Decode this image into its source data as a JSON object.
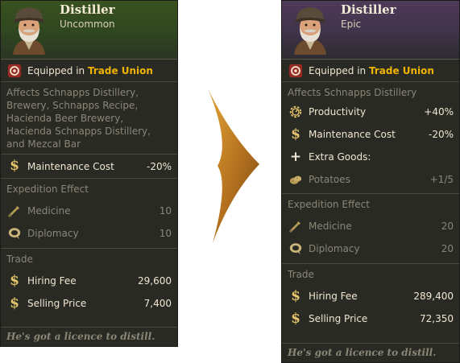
{
  "colors": {
    "uncommon": "#3a5220",
    "epic": "#4f3a5a",
    "highlight": "#f0b400",
    "gold": "#e4c46a"
  },
  "left": {
    "name": "Distiller",
    "rarity": "Uncommon",
    "equipped_prefix": "Equipped in",
    "equipped_place": "Trade Union",
    "affects": "Affects Schnapps Distillery, Brewery, Schnapps Recipe, Hacienda Beer Brewery, Hacienda Schnapps Distillery, and Mezcal Bar",
    "maintenance": {
      "label": "Maintenance Cost",
      "value": "-20%"
    },
    "expedition_title": "Expedition Effect",
    "medicine": {
      "label": "Medicine",
      "value": "10"
    },
    "diplomacy": {
      "label": "Diplomacy",
      "value": "10"
    },
    "trade_title": "Trade",
    "hiring": {
      "label": "Hiring Fee",
      "value": "29,600"
    },
    "selling": {
      "label": "Selling Price",
      "value": "7,400"
    },
    "flavor": "He's got a licence to distill."
  },
  "right": {
    "name": "Distiller",
    "rarity": "Epic",
    "equipped_prefix": "Equipped in",
    "equipped_place": "Trade Union",
    "affects": "Affects Schnapps Distillery",
    "productivity": {
      "label": "Productivity",
      "value": "+40%"
    },
    "maintenance": {
      "label": "Maintenance Cost",
      "value": "-20%"
    },
    "extra_goods": {
      "label": "Extra Goods:"
    },
    "potatoes": {
      "label": "Potatoes",
      "value": "+1/5"
    },
    "expedition_title": "Expedition Effect",
    "medicine": {
      "label": "Medicine",
      "value": "20"
    },
    "diplomacy": {
      "label": "Diplomacy",
      "value": "20"
    },
    "trade_title": "Trade",
    "hiring": {
      "label": "Hiring Fee",
      "value": "289,400"
    },
    "selling": {
      "label": "Selling Price",
      "value": "72,350"
    },
    "flavor": "He's got a licence to distill."
  },
  "icons": [
    "portrait",
    "trade-union-icon",
    "productivity-icon",
    "coin-icon",
    "plus-icon",
    "potato-icon",
    "medicine-icon",
    "diplomacy-icon",
    "arrow-right-icon"
  ]
}
